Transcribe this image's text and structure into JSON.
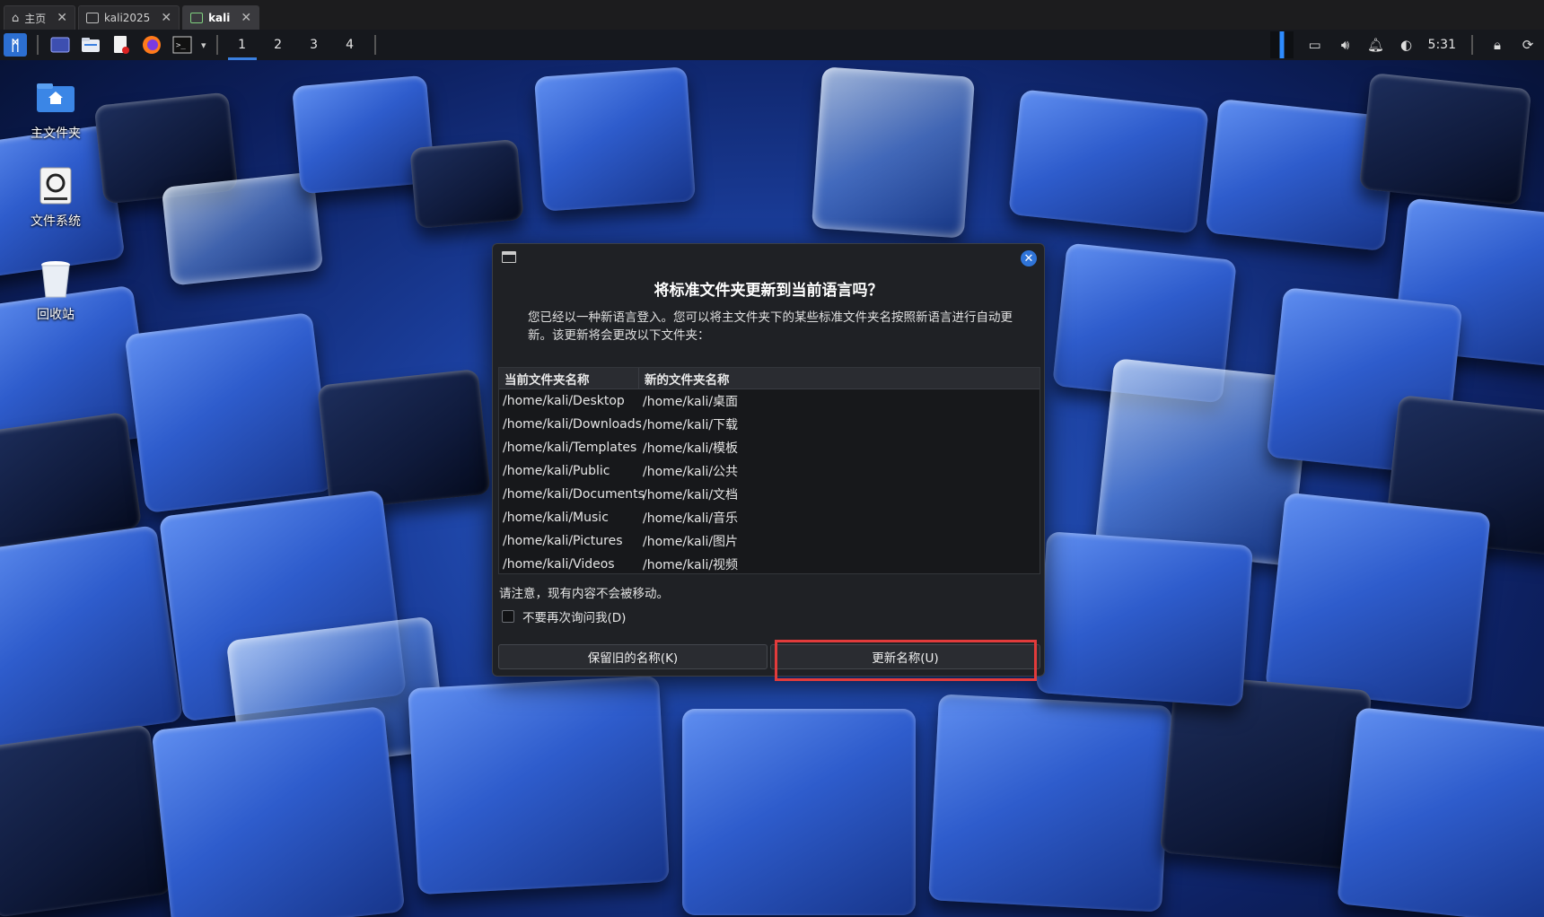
{
  "tabs": [
    {
      "label": "主页",
      "icon": "home-icon",
      "active": false
    },
    {
      "label": "kali2025",
      "icon": "vm-icon",
      "active": false
    },
    {
      "label": "kali",
      "icon": "vm-running-icon",
      "active": true
    }
  ],
  "panel": {
    "workspaces": [
      "1",
      "2",
      "3",
      "4"
    ],
    "active_workspace": "1",
    "clock": "5:31",
    "accent": "#3a7fe0"
  },
  "desktop": {
    "icons": [
      {
        "label": "主文件夹",
        "icon": "home-folder-icon"
      },
      {
        "label": "文件系统",
        "icon": "drive-icon"
      },
      {
        "label": "回收站",
        "icon": "trash-icon"
      }
    ]
  },
  "dialog": {
    "title": "将标准文件夹更新到当前语言吗？",
    "description": "您已经以一种新语言登入。您可以将主文件夹下的某些标准文件夹名按照新语言进行自动更新。该更新将会更改以下文件夹：",
    "table": {
      "headers": [
        "当前文件夹名称",
        "新的文件夹名称"
      ],
      "rows": [
        [
          "/home/kali/Desktop",
          "/home/kali/桌面"
        ],
        [
          "/home/kali/Downloads",
          "/home/kali/下载"
        ],
        [
          "/home/kali/Templates",
          "/home/kali/模板"
        ],
        [
          "/home/kali/Public",
          "/home/kali/公共"
        ],
        [
          "/home/kali/Documents",
          "/home/kali/文档"
        ],
        [
          "/home/kali/Music",
          "/home/kali/音乐"
        ],
        [
          "/home/kali/Pictures",
          "/home/kali/图片"
        ],
        [
          "/home/kali/Videos",
          "/home/kali/视频"
        ]
      ]
    },
    "note": "请注意，现有内容不会被移动。",
    "dont_ask_label": "不要再次询问我(D)",
    "dont_ask_checked": false,
    "keep_button": "保留旧的名称(K)",
    "update_button": "更新名称(U)",
    "highlight_color": "#e23b3b"
  }
}
